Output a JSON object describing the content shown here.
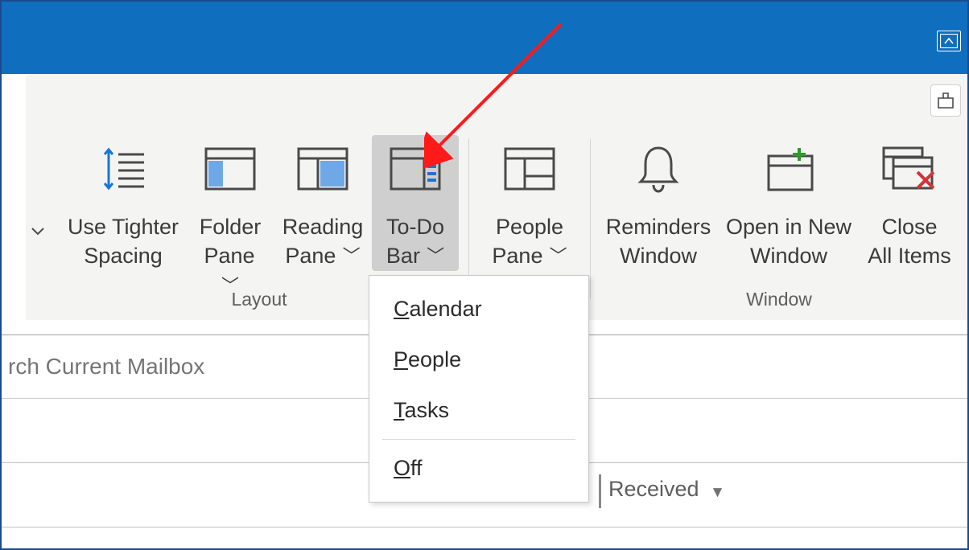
{
  "titlebar": {
    "collapse_aria": "Collapse the Ribbon"
  },
  "ribbon": {
    "addin_aria": "Add-ins",
    "groups": {
      "layout": {
        "label": "Layout",
        "tighter": {
          "line1": "Use Tighter",
          "line2": "Spacing"
        },
        "folder": {
          "line1": "Folder",
          "line2": "Pane"
        },
        "reading": {
          "line1": "Reading",
          "line2": "Pane"
        },
        "todo": {
          "line1": "To-Do",
          "line2": "Bar"
        }
      },
      "people": {
        "label": "",
        "people": {
          "line1": "People",
          "line2": "Pane"
        }
      },
      "window": {
        "label": "Window",
        "reminders": {
          "line1": "Reminders",
          "line2": "Window"
        },
        "opennew": {
          "line1": "Open in New",
          "line2": "Window"
        },
        "closeall": {
          "line1": "Close",
          "line2": "All Items"
        }
      }
    },
    "todo_menu": {
      "calendar": "alendar",
      "people": "eople",
      "tasks": "asks",
      "off": "ff"
    }
  },
  "search": {
    "placeholder": "rch Current Mailbox"
  },
  "sort": {
    "label": "Received"
  }
}
